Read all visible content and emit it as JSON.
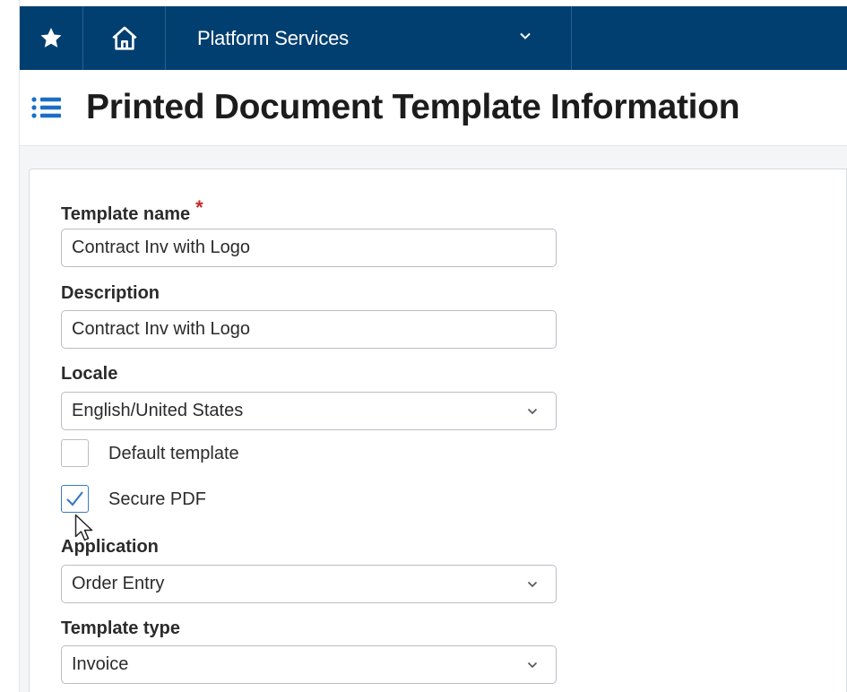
{
  "navbar": {
    "favorites_icon": "star-icon",
    "home_icon": "home-icon",
    "app_label": "Platform Services",
    "app_dropdown_icon": "chevron-down-icon"
  },
  "header": {
    "menu_icon": "list-icon",
    "title": "Printed Document Template Information"
  },
  "form": {
    "template_name": {
      "label": "Template name",
      "required_mark": "*",
      "value": "Contract Inv with Logo"
    },
    "description": {
      "label": "Description",
      "value": "Contract Inv with Logo"
    },
    "locale": {
      "label": "Locale",
      "value": "English/United States"
    },
    "default_template": {
      "label": "Default template",
      "checked": false
    },
    "secure_pdf": {
      "label": "Secure PDF",
      "checked": true
    },
    "application": {
      "label": "Application",
      "value": "Order Entry"
    },
    "template_type": {
      "label": "Template type",
      "value": "Invoice"
    }
  },
  "colors": {
    "navbar_bg": "#003f70",
    "required": "#c62828",
    "checkbox_accent": "#3a7bc1"
  }
}
